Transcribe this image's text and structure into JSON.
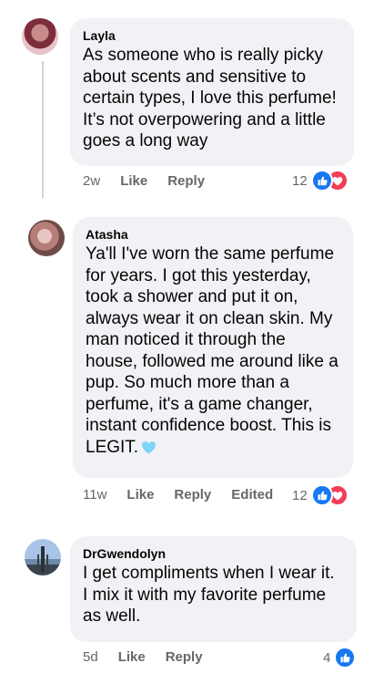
{
  "comments": [
    {
      "name": "Layla",
      "text": "As someone who is really picky\nabout scents and sensitive to\ncertain types, I love this perfume!\nIt’s not overpowering and a little\ngoes a long way",
      "time": "2w",
      "like": "Like",
      "reply": "Reply",
      "reaction_count": "12",
      "reactions": [
        "like-icon",
        "love-icon"
      ]
    },
    {
      "name": "Atasha",
      "text": "Ya'll I've worn the same perfume\nfor years. I got this yesterday,\ntook a shower and put it on,\nalways wear it on clean skin. My\nman noticed it through the\nhouse, followed me around like a\npup. So much more than a\nperfume, it's a game changer,\ninstant confidence boost. This is\nLEGIT.",
      "emoji": "light-blue-heart",
      "time": "11w",
      "like": "Like",
      "reply": "Reply",
      "edited": "Edited",
      "reaction_count": "12",
      "reactions": [
        "like-icon",
        "love-icon"
      ]
    },
    {
      "name": "DrGwendolyn",
      "text": "I get compliments when I wear it.\nI mix it with my favorite perfume\nas well.",
      "time": "5d",
      "like": "Like",
      "reply": "Reply",
      "reaction_count": "4",
      "reactions": [
        "like-icon"
      ]
    }
  ],
  "colors": {
    "bubble": "#f0f2f5",
    "meta_text": "#65676b",
    "like_blue": "#1877f2",
    "love_red": "#f33e58"
  }
}
